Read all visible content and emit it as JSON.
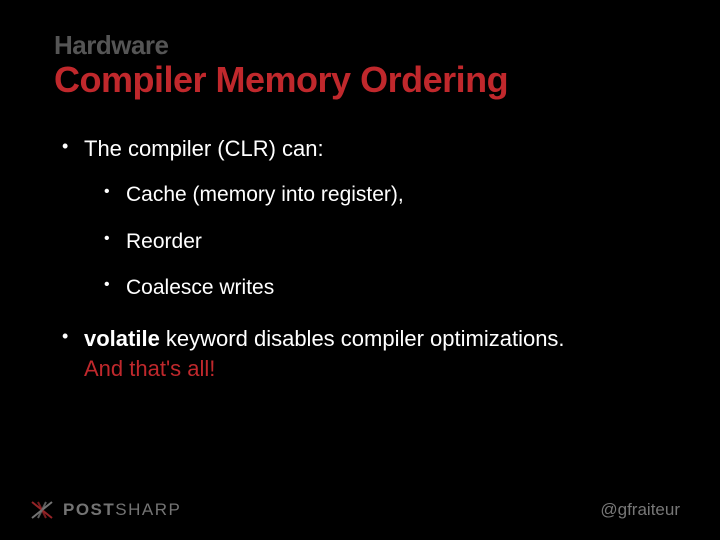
{
  "eyebrow": "Hardware",
  "title": "Compiler Memory Ordering",
  "bullets": {
    "lead": "The compiler (CLR) can:",
    "subs": [
      "Cache (memory into register),",
      "Reorder",
      "Coalesce writes"
    ],
    "volatile_kw": "volatile",
    "volatile_rest": " keyword disables compiler optimizations.",
    "volatile_warn": "And that's all!"
  },
  "footer": {
    "brand_bold": "POST",
    "brand_thin": "SHARP",
    "handle": "@gfraiteur"
  },
  "colors": {
    "accent": "#c0282c",
    "muted": "#555"
  }
}
